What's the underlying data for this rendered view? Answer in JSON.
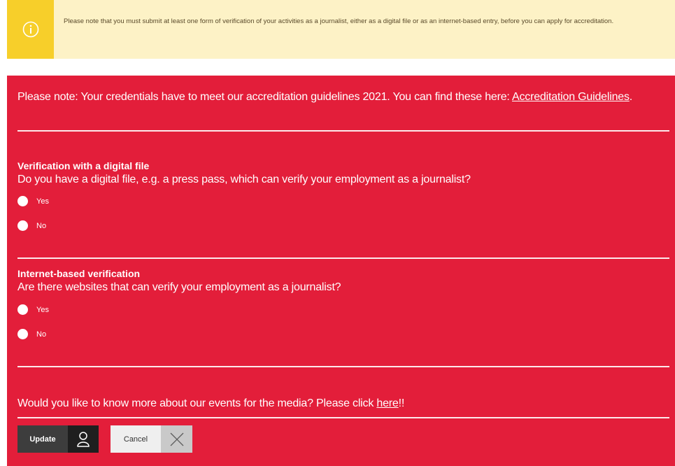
{
  "notice": {
    "text": "Please note that you must submit at least one form of verification of your activities as a journalist, either as a digital file or as an internet-based entry, before you can apply for accreditation.",
    "icon": "info-icon"
  },
  "intro": {
    "text": "Please note: Your credentials have to meet our accreditation guidelines 2021. You can find these here: ",
    "link": "Accreditation Guidelines",
    "after": "."
  },
  "digital": {
    "title": "Verification with a digital file",
    "question": "Do you have a digital file, e.g. a press pass, which can verify your employment as a journalist?",
    "options": [
      "Yes",
      "No"
    ]
  },
  "internet": {
    "title": "Internet-based verification",
    "question": "Are there websites that can verify your employment as a journalist?",
    "options": [
      "Yes",
      "No"
    ]
  },
  "more": {
    "text": "Would you like to know more about our events for the media? Please click ",
    "link": "here",
    "after": "!!"
  },
  "buttons": {
    "update": "Update",
    "cancel": "Cancel"
  },
  "colors": {
    "panel": "#e31e3a",
    "notice_bg": "#fdf2c6",
    "notice_icon_bg": "#f7cf2a"
  }
}
